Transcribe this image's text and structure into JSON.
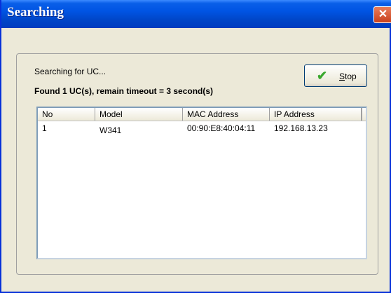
{
  "window": {
    "title": "Searching",
    "close_icon": "close-icon"
  },
  "status": {
    "searching_text": "Searching for UC...",
    "found_text": "Found 1 UC(s), remain timeout = 3 second(s)"
  },
  "stop_button": {
    "label": "Stop",
    "icon": "checkmark-icon"
  },
  "table": {
    "columns": [
      "No",
      "Model",
      "MAC Address",
      "IP Address"
    ],
    "rows": [
      {
        "no": "1",
        "model": "W341",
        "mac": "00:90:E8:40:04:11",
        "ip": "192.168.13.23"
      }
    ]
  }
}
